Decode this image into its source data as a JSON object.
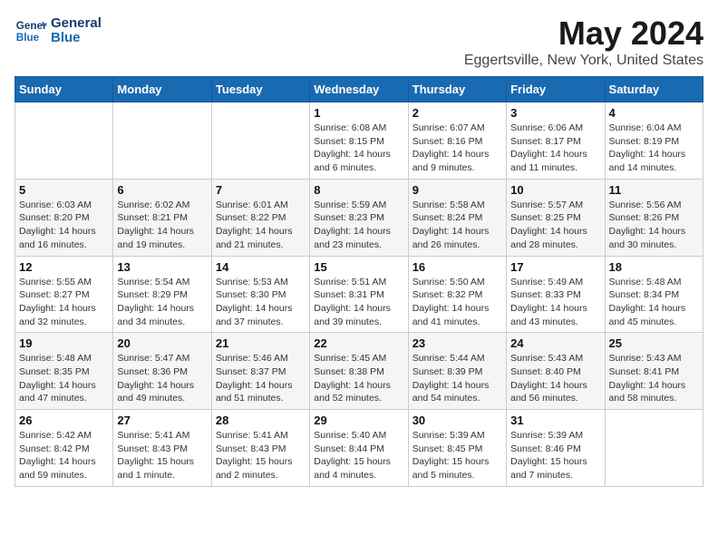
{
  "header": {
    "logo_line1": "General",
    "logo_line2": "Blue",
    "title": "May 2024",
    "subtitle": "Eggertsville, New York, United States"
  },
  "days_of_week": [
    "Sunday",
    "Monday",
    "Tuesday",
    "Wednesday",
    "Thursday",
    "Friday",
    "Saturday"
  ],
  "weeks": [
    [
      {
        "day": "",
        "info": ""
      },
      {
        "day": "",
        "info": ""
      },
      {
        "day": "",
        "info": ""
      },
      {
        "day": "1",
        "info": "Sunrise: 6:08 AM\nSunset: 8:15 PM\nDaylight: 14 hours\nand 6 minutes."
      },
      {
        "day": "2",
        "info": "Sunrise: 6:07 AM\nSunset: 8:16 PM\nDaylight: 14 hours\nand 9 minutes."
      },
      {
        "day": "3",
        "info": "Sunrise: 6:06 AM\nSunset: 8:17 PM\nDaylight: 14 hours\nand 11 minutes."
      },
      {
        "day": "4",
        "info": "Sunrise: 6:04 AM\nSunset: 8:19 PM\nDaylight: 14 hours\nand 14 minutes."
      }
    ],
    [
      {
        "day": "5",
        "info": "Sunrise: 6:03 AM\nSunset: 8:20 PM\nDaylight: 14 hours\nand 16 minutes."
      },
      {
        "day": "6",
        "info": "Sunrise: 6:02 AM\nSunset: 8:21 PM\nDaylight: 14 hours\nand 19 minutes."
      },
      {
        "day": "7",
        "info": "Sunrise: 6:01 AM\nSunset: 8:22 PM\nDaylight: 14 hours\nand 21 minutes."
      },
      {
        "day": "8",
        "info": "Sunrise: 5:59 AM\nSunset: 8:23 PM\nDaylight: 14 hours\nand 23 minutes."
      },
      {
        "day": "9",
        "info": "Sunrise: 5:58 AM\nSunset: 8:24 PM\nDaylight: 14 hours\nand 26 minutes."
      },
      {
        "day": "10",
        "info": "Sunrise: 5:57 AM\nSunset: 8:25 PM\nDaylight: 14 hours\nand 28 minutes."
      },
      {
        "day": "11",
        "info": "Sunrise: 5:56 AM\nSunset: 8:26 PM\nDaylight: 14 hours\nand 30 minutes."
      }
    ],
    [
      {
        "day": "12",
        "info": "Sunrise: 5:55 AM\nSunset: 8:27 PM\nDaylight: 14 hours\nand 32 minutes."
      },
      {
        "day": "13",
        "info": "Sunrise: 5:54 AM\nSunset: 8:29 PM\nDaylight: 14 hours\nand 34 minutes."
      },
      {
        "day": "14",
        "info": "Sunrise: 5:53 AM\nSunset: 8:30 PM\nDaylight: 14 hours\nand 37 minutes."
      },
      {
        "day": "15",
        "info": "Sunrise: 5:51 AM\nSunset: 8:31 PM\nDaylight: 14 hours\nand 39 minutes."
      },
      {
        "day": "16",
        "info": "Sunrise: 5:50 AM\nSunset: 8:32 PM\nDaylight: 14 hours\nand 41 minutes."
      },
      {
        "day": "17",
        "info": "Sunrise: 5:49 AM\nSunset: 8:33 PM\nDaylight: 14 hours\nand 43 minutes."
      },
      {
        "day": "18",
        "info": "Sunrise: 5:48 AM\nSunset: 8:34 PM\nDaylight: 14 hours\nand 45 minutes."
      }
    ],
    [
      {
        "day": "19",
        "info": "Sunrise: 5:48 AM\nSunset: 8:35 PM\nDaylight: 14 hours\nand 47 minutes."
      },
      {
        "day": "20",
        "info": "Sunrise: 5:47 AM\nSunset: 8:36 PM\nDaylight: 14 hours\nand 49 minutes."
      },
      {
        "day": "21",
        "info": "Sunrise: 5:46 AM\nSunset: 8:37 PM\nDaylight: 14 hours\nand 51 minutes."
      },
      {
        "day": "22",
        "info": "Sunrise: 5:45 AM\nSunset: 8:38 PM\nDaylight: 14 hours\nand 52 minutes."
      },
      {
        "day": "23",
        "info": "Sunrise: 5:44 AM\nSunset: 8:39 PM\nDaylight: 14 hours\nand 54 minutes."
      },
      {
        "day": "24",
        "info": "Sunrise: 5:43 AM\nSunset: 8:40 PM\nDaylight: 14 hours\nand 56 minutes."
      },
      {
        "day": "25",
        "info": "Sunrise: 5:43 AM\nSunset: 8:41 PM\nDaylight: 14 hours\nand 58 minutes."
      }
    ],
    [
      {
        "day": "26",
        "info": "Sunrise: 5:42 AM\nSunset: 8:42 PM\nDaylight: 14 hours\nand 59 minutes."
      },
      {
        "day": "27",
        "info": "Sunrise: 5:41 AM\nSunset: 8:43 PM\nDaylight: 15 hours\nand 1 minute."
      },
      {
        "day": "28",
        "info": "Sunrise: 5:41 AM\nSunset: 8:43 PM\nDaylight: 15 hours\nand 2 minutes."
      },
      {
        "day": "29",
        "info": "Sunrise: 5:40 AM\nSunset: 8:44 PM\nDaylight: 15 hours\nand 4 minutes."
      },
      {
        "day": "30",
        "info": "Sunrise: 5:39 AM\nSunset: 8:45 PM\nDaylight: 15 hours\nand 5 minutes."
      },
      {
        "day": "31",
        "info": "Sunrise: 5:39 AM\nSunset: 8:46 PM\nDaylight: 15 hours\nand 7 minutes."
      },
      {
        "day": "",
        "info": ""
      }
    ]
  ]
}
